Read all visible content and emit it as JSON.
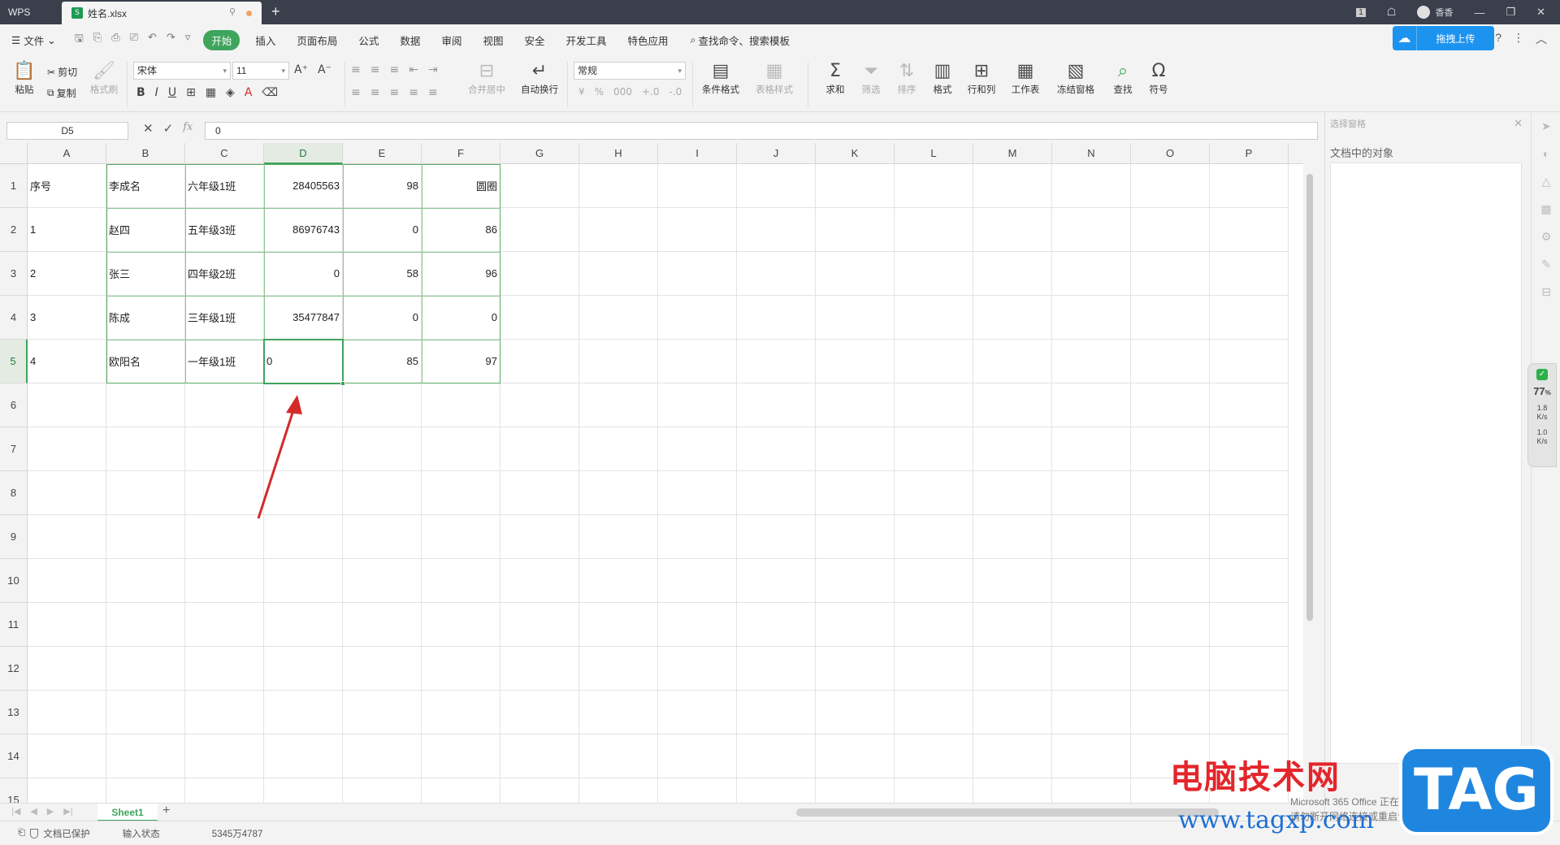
{
  "titlebar": {
    "app": "WPS",
    "doc_tab": "姓名.xlsx",
    "badge": "1",
    "user": "香香",
    "new_tab": "+"
  },
  "menu": {
    "file": "文件",
    "items": [
      "开始",
      "插入",
      "页面布局",
      "公式",
      "数据",
      "审阅",
      "视图",
      "安全",
      "开发工具",
      "特色应用"
    ],
    "search": "查找命令、搜索模板",
    "upload": "拖拽上传",
    "help": "?"
  },
  "ribbon": {
    "paste": "粘贴",
    "cut": "剪切",
    "copy": "复制",
    "format_painter": "格式刷",
    "font": "宋体",
    "font_size": "11",
    "merge": "合并居中",
    "wrap": "自动换行",
    "number_format": "常规",
    "cond_format": "条件格式",
    "table_style": "表格样式",
    "sum": "求和",
    "filter": "筛选",
    "sort": "排序",
    "format": "格式",
    "rowcol": "行和列",
    "worksheet": "工作表",
    "freeze": "冻结窗格",
    "find": "查找",
    "symbol": "符号"
  },
  "formula_bar": {
    "name_box": "D5",
    "value": "0",
    "fx": "fx"
  },
  "columns": [
    "A",
    "B",
    "C",
    "D",
    "E",
    "F",
    "G",
    "H",
    "I",
    "J",
    "K",
    "L",
    "M",
    "N",
    "O",
    "P"
  ],
  "rows": [
    "1",
    "2",
    "3",
    "4",
    "5",
    "6",
    "7",
    "8",
    "9",
    "10",
    "11",
    "12",
    "13",
    "14",
    "15"
  ],
  "cells": [
    [
      "序号",
      "李成名",
      "六年级1班",
      "28405563",
      "98",
      "圆圈"
    ],
    [
      "1",
      "赵四",
      "五年级3班",
      "86976743",
      "0",
      "86"
    ],
    [
      "2",
      "张三",
      "四年级2班",
      "0",
      "58",
      "96"
    ],
    [
      "3",
      "陈成",
      "三年级1班",
      "35477847",
      "0",
      "0"
    ],
    [
      "4",
      "欧阳名",
      "一年级1班",
      "0",
      "85",
      "97"
    ]
  ],
  "selected_cell": "D5",
  "sheets": [
    "Sheet1"
  ],
  "status": {
    "protect": "文档已保护",
    "mode": "输入状态",
    "extra": "5345万4787"
  },
  "right_panel": {
    "title": "选择窗格",
    "label": "文档中的对象"
  },
  "meter": {
    "pct": "77",
    "unit": "%",
    "up": "1.8",
    "down": "1.0",
    "rate": "K/s"
  },
  "watermark": {
    "text": "电脑技术网",
    "url": "www.tagxp.com",
    "tag": "TAG"
  },
  "notification": {
    "line1": "Microsoft 365 Office 正在后台安装",
    "line2": "请勿断开网络连接或重启计算机"
  },
  "colors": {
    "accent": "#3fa45c",
    "titlebar": "#3a3f4b",
    "upload": "#1d93f0",
    "arrow": "#d42a2a"
  }
}
